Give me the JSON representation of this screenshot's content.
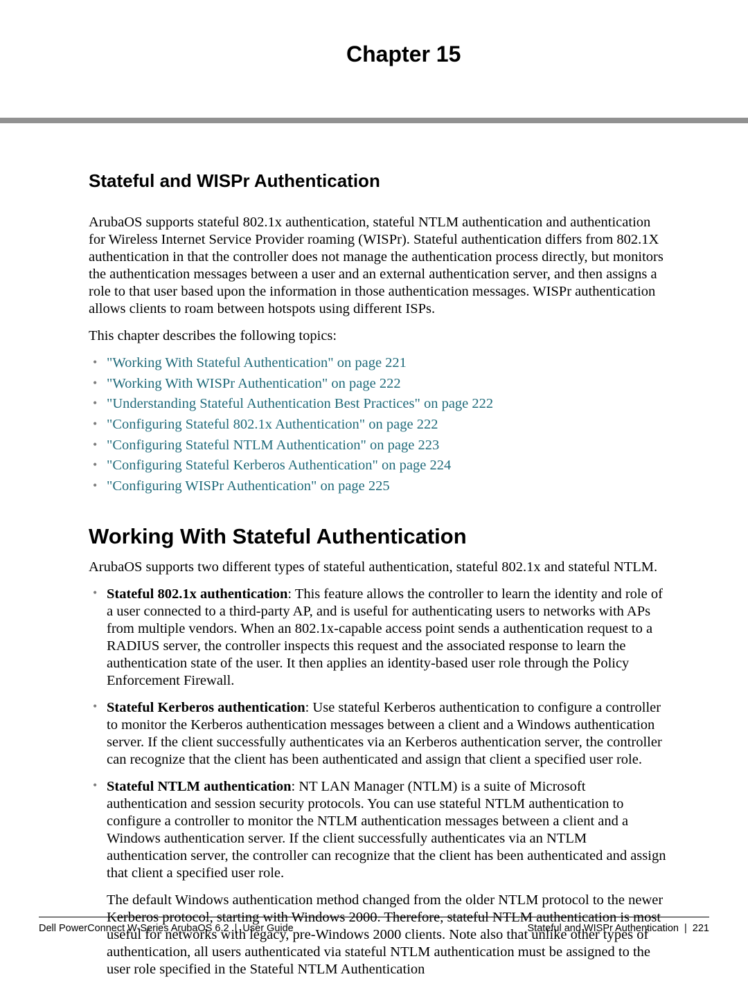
{
  "chapter": {
    "label": "Chapter 15"
  },
  "title": "Stateful and WISPr Authentication",
  "intro": "ArubaOS supports stateful 802.1x authentication, stateful NTLM authentication and authentication for Wireless Internet Service Provider roaming (WISPr). Stateful authentication differs from 802.1X authentication in that the controller does not manage the authentication process directly, but monitors the authentication messages between a user and an external authentication server, and then assigns a role to that user based upon the information in those authentication messages. WISPr authentication allows clients to roam between hotspots using different ISPs.",
  "topics_lead": "This chapter describes the following topics:",
  "toc": [
    "\"Working With Stateful Authentication\" on page 221",
    "\"Working With WISPr Authentication\" on page 222",
    "\"Understanding Stateful Authentication Best Practices\" on page 222",
    "\"Configuring Stateful 802.1x Authentication\" on page 222",
    "\"Configuring Stateful NTLM Authentication\" on page 223",
    "\"Configuring Stateful Kerberos Authentication\" on page 224",
    "\"Configuring WISPr Authentication\" on page 225"
  ],
  "section_heading": "Working With Stateful Authentication",
  "section_intro": "ArubaOS supports two different types of stateful authentication, stateful 802.1x and stateful NTLM.",
  "defs": [
    {
      "term": "Stateful 802.1x authentication",
      "body": ": This feature allows the controller to learn the identity and role of a user connected to a third-party AP, and is useful for authenticating users to networks with APs from multiple vendors. When an 802.1x-capable access point sends a authentication request to a RADIUS server, the controller inspects this request and the associated response to learn the authentication state of the user. It then applies an identity-based user role through the Policy Enforcement Firewall."
    },
    {
      "term": "Stateful Kerberos authentication",
      "body": ": Use stateful Kerberos authentication to configure a controller to monitor the Kerberos authentication messages between a client and a Windows authentication server. If the client successfully authenticates via an Kerberos authentication server, the controller can recognize that the client has been authenticated and assign that client a specified user role."
    },
    {
      "term": "Stateful NTLM authentication",
      "body": ": NT LAN Manager (NTLM) is a suite of Microsoft authentication and session security protocols. You can use stateful NTLM authentication to configure a controller to monitor the NTLM authentication messages between a client and a Windows authentication server. If the client successfully authenticates via an NTLM authentication server, the controller can recognize that the client has been authenticated and assign that client a specified user role.",
      "extra": "The default Windows authentication method changed from the older NTLM protocol to the newer Kerberos protocol, starting with Windows 2000. Therefore, stateful NTLM authentication is most useful for networks with legacy, pre-Windows 2000 clients. Note also that unlike other types of authentication, all users authenticated via stateful NTLM authentication must be assigned to the user role specified in the Stateful NTLM Authentication"
    }
  ],
  "footer": {
    "left_product": "Dell PowerConnect W-Series ArubaOS 6.2",
    "left_doc": "User Guide",
    "right_section": "Stateful and WISPr Authentication",
    "right_page": "221",
    "sep": "|"
  }
}
